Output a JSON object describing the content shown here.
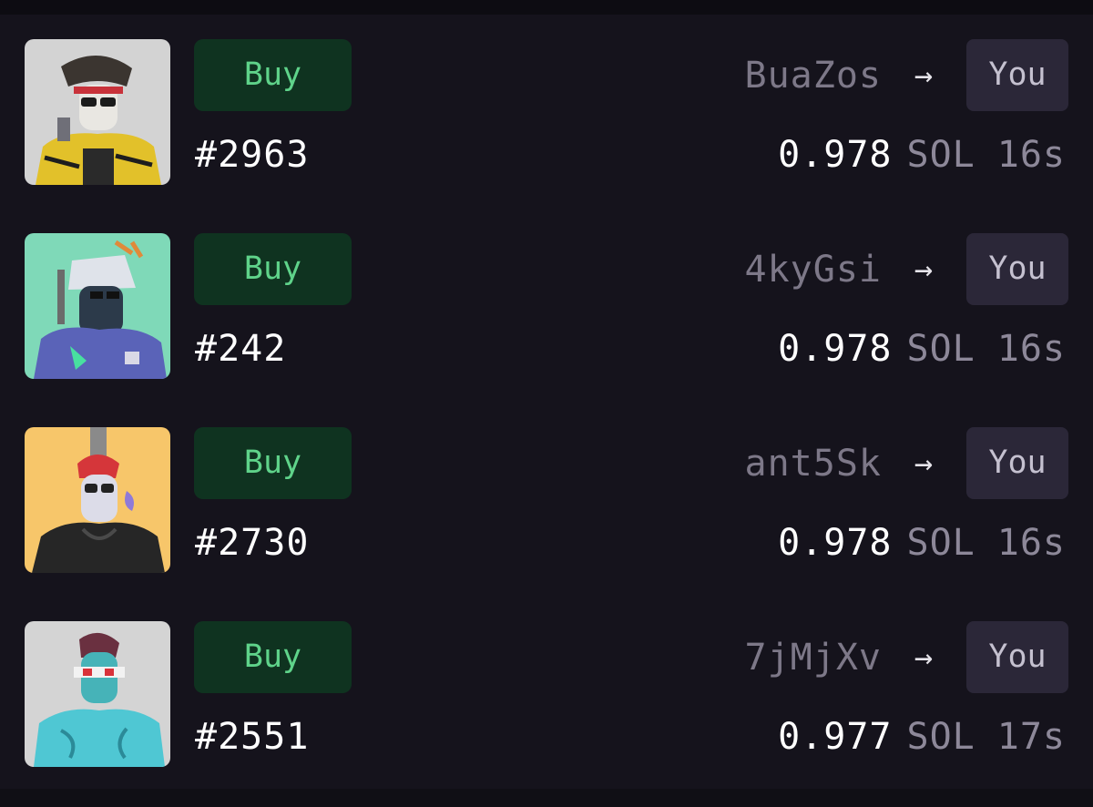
{
  "rows": [
    {
      "buy_label": "Buy",
      "id": "#2963",
      "sender": "BuaZos",
      "arrow": "→",
      "recipient": "You",
      "price": "0.978",
      "unit": "SOL",
      "age": "16s",
      "thumb_bg": "#d3d3d3"
    },
    {
      "buy_label": "Buy",
      "id": "#242",
      "sender": "4kyGsi",
      "arrow": "→",
      "recipient": "You",
      "price": "0.978",
      "unit": "SOL",
      "age": "16s",
      "thumb_bg": "#7fd9b8"
    },
    {
      "buy_label": "Buy",
      "id": "#2730",
      "sender": "ant5Sk",
      "arrow": "→",
      "recipient": "You",
      "price": "0.978",
      "unit": "SOL",
      "age": "16s",
      "thumb_bg": "#f7c66a"
    },
    {
      "buy_label": "Buy",
      "id": "#2551",
      "sender": "7jMjXv",
      "arrow": "→",
      "recipient": "You",
      "price": "0.977",
      "unit": "SOL",
      "age": "17s",
      "thumb_bg": "#d4d4d4"
    }
  ],
  "colors": {
    "background": "#15131c",
    "buy_bg": "#0f3320",
    "buy_text": "#5fd38a",
    "you_bg": "#2b2738",
    "muted_text": "#7d7888"
  },
  "icons": {
    "arrow": "right-arrow-icon",
    "thumbnail": "nft-avatar-thumbnail"
  }
}
